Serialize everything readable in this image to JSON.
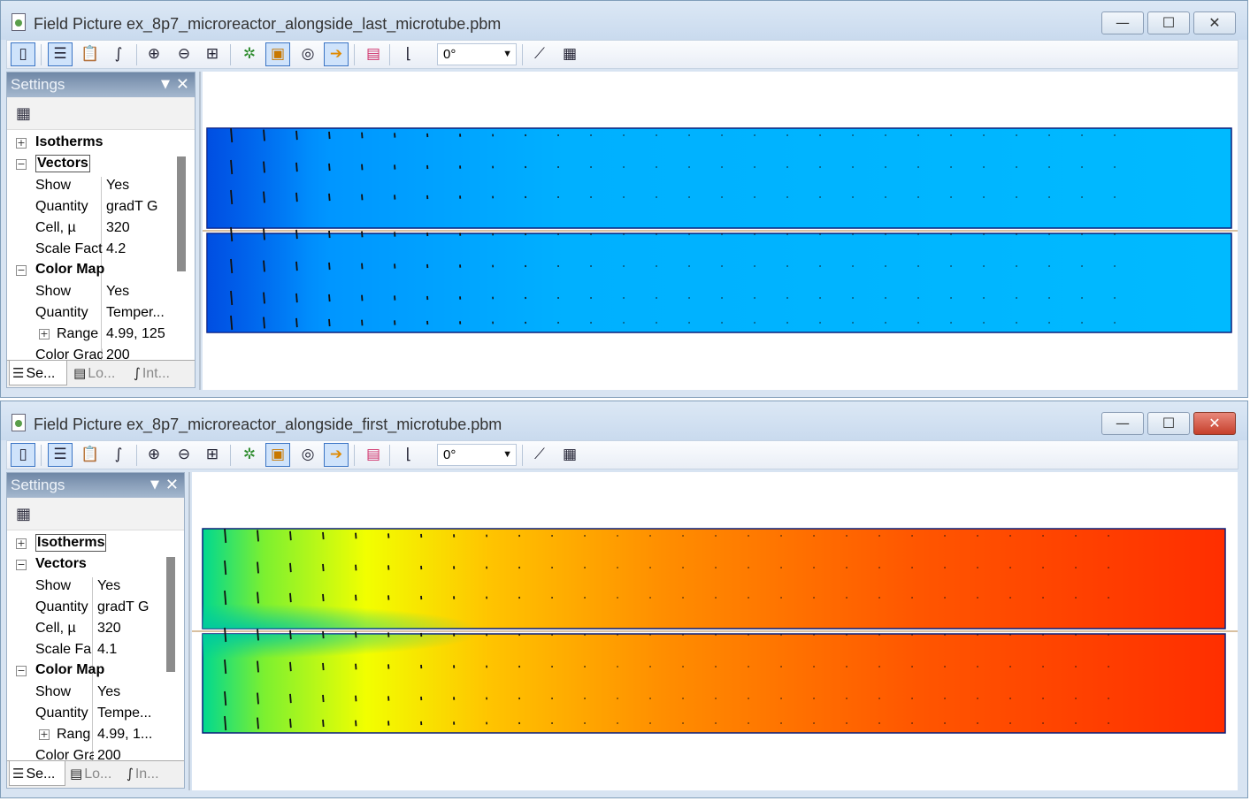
{
  "windows": [
    {
      "id": "last",
      "title": "Field Picture ex_8p7_microreactor_alongside_last_microtube.pbm",
      "rotation": "0°",
      "settings": {
        "header": "Settings",
        "groups": {
          "isotherms": "Isotherms",
          "vectors": "Vectors",
          "color_map": "Color Map"
        },
        "rows": {
          "vec_show": [
            "Show",
            "Yes"
          ],
          "vec_quantity": [
            "Quantity",
            "gradT G"
          ],
          "vec_cell": [
            "Cell, µ",
            "320"
          ],
          "vec_scale": [
            "Scale Fact",
            "4.2"
          ],
          "cm_show": [
            "Show",
            "Yes"
          ],
          "cm_quantity": [
            "Quantity",
            "Temper..."
          ],
          "cm_range": [
            "Range",
            "4.99, 125"
          ],
          "cm_grad": [
            "Color Grad",
            "200"
          ]
        },
        "tabs": [
          "Se...",
          "Lo...",
          "Int..."
        ]
      },
      "field": {
        "palette": "cold-blue",
        "gradient_colors": [
          "#0050e8",
          "#00b8ff"
        ]
      }
    },
    {
      "id": "first",
      "title": "Field Picture ex_8p7_microreactor_alongside_first_microtube.pbm",
      "rotation": "0°",
      "settings": {
        "header": "Settings",
        "groups": {
          "isotherms": "Isotherms",
          "vectors": "Vectors",
          "color_map": "Color Map"
        },
        "rows": {
          "vec_show": [
            "Show",
            "Yes"
          ],
          "vec_quantity": [
            "Quantity",
            "gradT G"
          ],
          "vec_cell": [
            "Cell, µ",
            "320"
          ],
          "vec_scale": [
            "Scale Fa",
            "4.1"
          ],
          "cm_show": [
            "Show",
            "Yes"
          ],
          "cm_quantity": [
            "Quantity",
            "Tempe..."
          ],
          "cm_range": [
            "Rang",
            "4.99, 1..."
          ],
          "cm_grad": [
            "Color Gra",
            "200"
          ]
        },
        "tabs": [
          "Se...",
          "Lo...",
          "In..."
        ]
      },
      "field": {
        "palette": "hot-rainbow",
        "gradient_colors": [
          "#00d28a",
          "#f4ff00",
          "#ff8a00",
          "#ff2a00"
        ]
      }
    }
  ],
  "window_buttons": {
    "minimize": "—",
    "maximize": "☐",
    "close": "✕"
  },
  "toolbar_icons": [
    "panel-toggle-icon",
    "settings-sliders-icon",
    "clipboard-icon",
    "integral-icon",
    "zoom-in-icon",
    "zoom-out-icon",
    "fit-window-icon",
    "mesh-icon",
    "3d-box-icon",
    "target-icon",
    "flow-arrows-icon",
    "color-scale-icon",
    "new-point-icon",
    "rotation-select",
    "plot-icon",
    "table-icon"
  ]
}
